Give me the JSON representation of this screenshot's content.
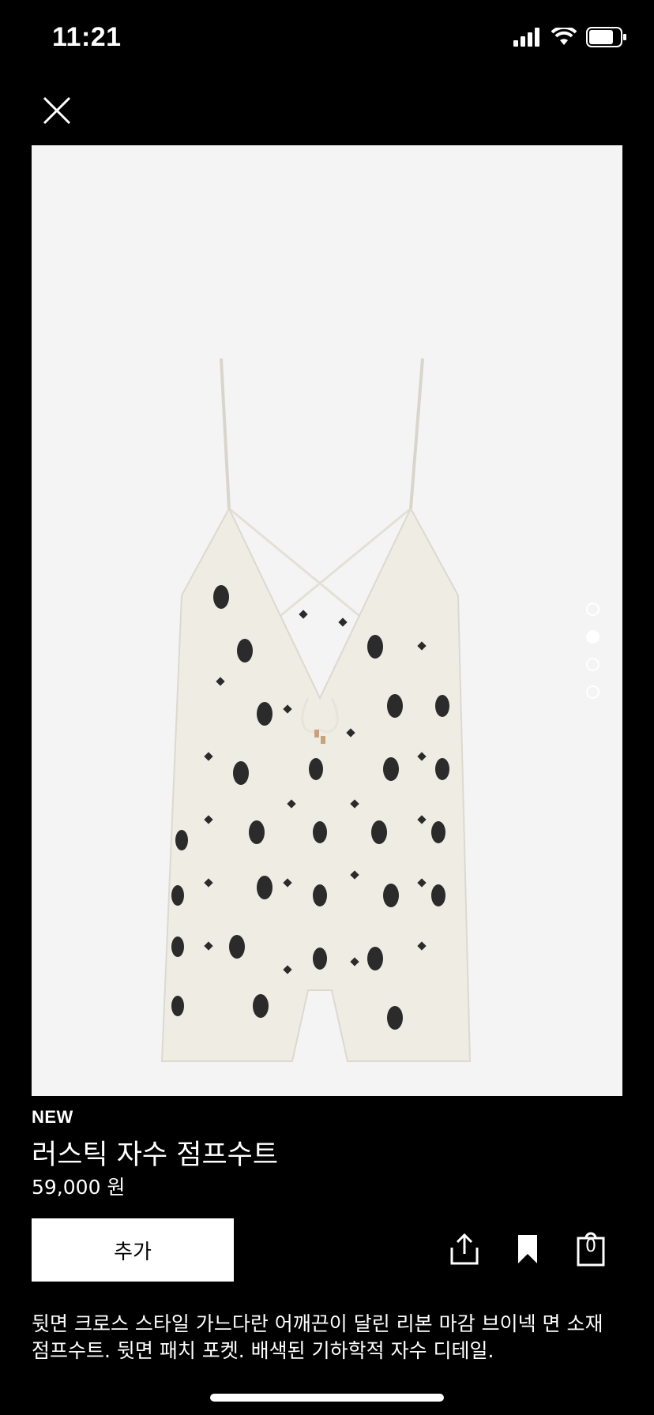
{
  "status_bar": {
    "time": "11:21"
  },
  "product": {
    "badge": "NEW",
    "title": "러스틱 자수 점프수트",
    "price": "59,000 원",
    "description": "뒷면 크로스 스타일 가느다란 어깨끈이 달린 리본 마감 브이넥 면 소재 점프수트. 뒷면 패치 포켓. 배색된 기하학적 자수 디테일."
  },
  "image_carousel": {
    "total_images": 4,
    "active_index": 1
  },
  "actions": {
    "add_label": "추가",
    "bag_count": "0"
  },
  "icons": [
    "close-icon",
    "share-icon",
    "bookmark-icon",
    "bag-icon"
  ],
  "colors": {
    "background": "#000000",
    "image_bg": "#f4f4f4",
    "primary_button": "#ffffff"
  }
}
